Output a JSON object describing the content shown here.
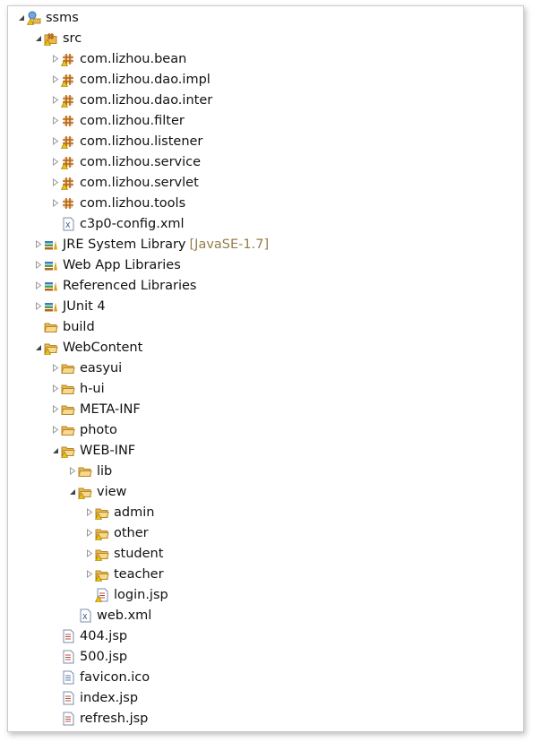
{
  "colors": {
    "folder": "#e9b94f",
    "package": "#b5651d",
    "warning": "#f2c200",
    "suffix": "#957d47"
  },
  "tree": [
    {
      "level": 0,
      "state": "expanded",
      "icon": "project-icon",
      "warn": true,
      "label": "ssms"
    },
    {
      "level": 1,
      "state": "expanded",
      "icon": "source-folder-icon",
      "warn": true,
      "label": "src"
    },
    {
      "level": 2,
      "state": "collapsed",
      "icon": "package-icon",
      "warn": true,
      "label": "com.lizhou.bean"
    },
    {
      "level": 2,
      "state": "collapsed",
      "icon": "package-icon",
      "warn": true,
      "label": "com.lizhou.dao.impl"
    },
    {
      "level": 2,
      "state": "collapsed",
      "icon": "package-icon",
      "warn": true,
      "label": "com.lizhou.dao.inter"
    },
    {
      "level": 2,
      "state": "collapsed",
      "icon": "package-icon",
      "warn": false,
      "label": "com.lizhou.filter"
    },
    {
      "level": 2,
      "state": "collapsed",
      "icon": "package-icon",
      "warn": true,
      "label": "com.lizhou.listener"
    },
    {
      "level": 2,
      "state": "collapsed",
      "icon": "package-icon",
      "warn": true,
      "label": "com.lizhou.service"
    },
    {
      "level": 2,
      "state": "collapsed",
      "icon": "package-icon",
      "warn": true,
      "label": "com.lizhou.servlet"
    },
    {
      "level": 2,
      "state": "collapsed",
      "icon": "package-icon",
      "warn": false,
      "label": "com.lizhou.tools"
    },
    {
      "level": 2,
      "state": "none",
      "icon": "xml-file-icon",
      "warn": false,
      "label": "c3p0-config.xml"
    },
    {
      "level": 1,
      "state": "collapsed",
      "icon": "library-icon",
      "warn": false,
      "label": "JRE System Library",
      "suffix": "[JavaSE-1.7]"
    },
    {
      "level": 1,
      "state": "collapsed",
      "icon": "library-icon",
      "warn": false,
      "label": "Web App Libraries"
    },
    {
      "level": 1,
      "state": "collapsed",
      "icon": "library-icon",
      "warn": false,
      "label": "Referenced Libraries"
    },
    {
      "level": 1,
      "state": "collapsed",
      "icon": "library-icon",
      "warn": false,
      "label": "JUnit 4"
    },
    {
      "level": 1,
      "state": "none",
      "icon": "folder-icon",
      "warn": false,
      "label": "build"
    },
    {
      "level": 1,
      "state": "expanded",
      "icon": "folder-icon",
      "warn": true,
      "label": "WebContent"
    },
    {
      "level": 2,
      "state": "collapsed",
      "icon": "folder-icon",
      "warn": false,
      "label": "easyui"
    },
    {
      "level": 2,
      "state": "collapsed",
      "icon": "folder-icon",
      "warn": false,
      "label": "h-ui"
    },
    {
      "level": 2,
      "state": "collapsed",
      "icon": "folder-icon",
      "warn": false,
      "label": "META-INF"
    },
    {
      "level": 2,
      "state": "collapsed",
      "icon": "folder-icon",
      "warn": false,
      "label": "photo"
    },
    {
      "level": 2,
      "state": "expanded",
      "icon": "folder-icon",
      "warn": true,
      "label": "WEB-INF"
    },
    {
      "level": 3,
      "state": "collapsed",
      "icon": "folder-icon",
      "warn": false,
      "label": "lib"
    },
    {
      "level": 3,
      "state": "expanded",
      "icon": "folder-icon",
      "warn": true,
      "label": "view"
    },
    {
      "level": 4,
      "state": "collapsed",
      "icon": "folder-icon",
      "warn": true,
      "label": "admin"
    },
    {
      "level": 4,
      "state": "collapsed",
      "icon": "folder-icon",
      "warn": true,
      "label": "other"
    },
    {
      "level": 4,
      "state": "collapsed",
      "icon": "folder-icon",
      "warn": true,
      "label": "student"
    },
    {
      "level": 4,
      "state": "collapsed",
      "icon": "folder-icon",
      "warn": true,
      "label": "teacher"
    },
    {
      "level": 4,
      "state": "none",
      "icon": "jsp-file-icon",
      "warn": true,
      "label": "login.jsp"
    },
    {
      "level": 3,
      "state": "none",
      "icon": "xml-file-icon",
      "warn": false,
      "label": "web.xml"
    },
    {
      "level": 2,
      "state": "none",
      "icon": "jsp-file-icon",
      "warn": false,
      "label": "404.jsp"
    },
    {
      "level": 2,
      "state": "none",
      "icon": "jsp-file-icon",
      "warn": false,
      "label": "500.jsp"
    },
    {
      "level": 2,
      "state": "none",
      "icon": "text-file-icon",
      "warn": false,
      "label": "favicon.ico"
    },
    {
      "level": 2,
      "state": "none",
      "icon": "jsp-file-icon",
      "warn": false,
      "label": "index.jsp"
    },
    {
      "level": 2,
      "state": "none",
      "icon": "jsp-file-icon",
      "warn": false,
      "label": "refresh.jsp"
    }
  ]
}
